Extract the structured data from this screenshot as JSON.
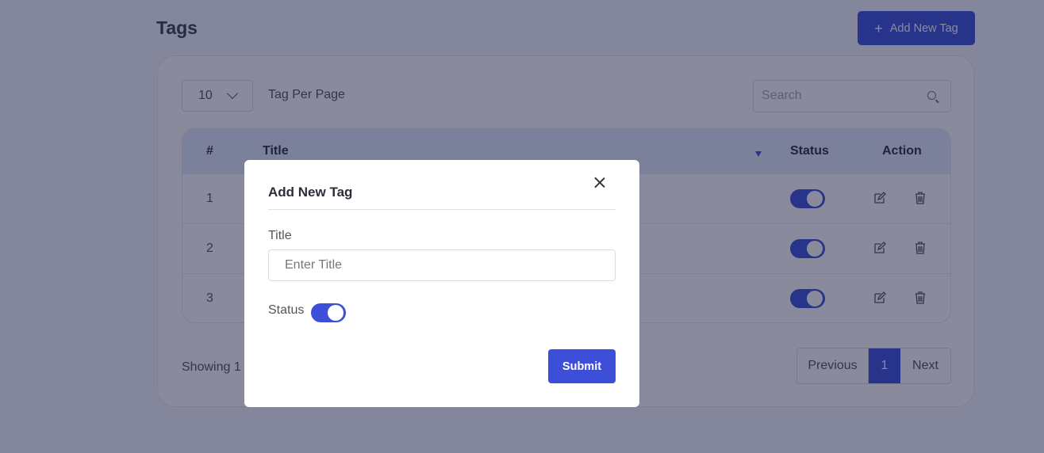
{
  "page": {
    "title": "Tags",
    "add_button_label": "Add New Tag"
  },
  "controls": {
    "per_page_value": "10",
    "per_page_label": "Tag Per Page",
    "search_placeholder": "Search"
  },
  "table": {
    "headers": {
      "num": "#",
      "title": "Title",
      "status": "Status",
      "action": "Action"
    },
    "rows": [
      {
        "num": "1",
        "status_on": true
      },
      {
        "num": "2",
        "status_on": true
      },
      {
        "num": "3",
        "status_on": true
      }
    ]
  },
  "footer": {
    "showing_text": "Showing 1 t",
    "previous_label": "Previous",
    "page_label": "1",
    "next_label": "Next"
  },
  "modal": {
    "title": "Add New Tag",
    "title_field_label": "Title",
    "title_placeholder": "Enter Title",
    "status_label": "Status",
    "status_on": true,
    "submit_label": "Submit"
  },
  "colors": {
    "accent": "#3d4fd8",
    "header_bg": "#e3e8fb",
    "overlay": "rgba(20,24,60,0.5)"
  }
}
